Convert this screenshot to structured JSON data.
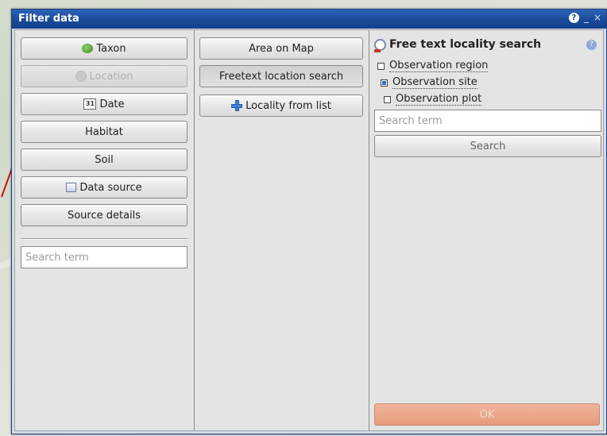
{
  "window": {
    "title": "Filter data"
  },
  "categories": [
    {
      "label": "Taxon",
      "icon": "bug-icon"
    },
    {
      "label": "Location",
      "icon": "globe-icon",
      "disabled": true
    },
    {
      "label": "Date",
      "icon": "calendar-icon",
      "icon_text": "31"
    },
    {
      "label": "Habitat"
    },
    {
      "label": "Soil"
    },
    {
      "label": "Data source",
      "icon": "datasource-icon"
    },
    {
      "label": "Source details"
    }
  ],
  "left_search": {
    "placeholder": "Search term"
  },
  "location_options": [
    {
      "label": "Area on Map"
    },
    {
      "label": "Freetext location search",
      "selected": true
    },
    {
      "label": "Locality from list",
      "icon": "plus-icon"
    }
  ],
  "free_text_panel": {
    "title": "Free text locality search",
    "checkboxes": [
      {
        "label": "Observation region",
        "checked": false
      },
      {
        "label": "Observation site",
        "checked": true
      },
      {
        "label": "Observation plot",
        "checked": false
      }
    ],
    "search_placeholder": "Search term",
    "search_button": "Search",
    "ok_button": "OK"
  }
}
